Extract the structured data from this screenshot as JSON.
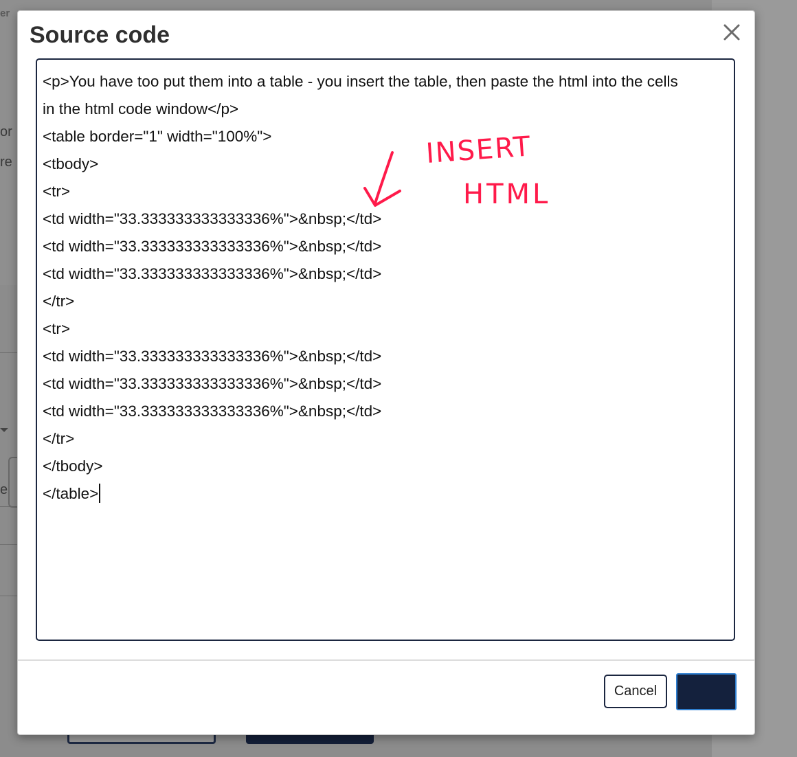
{
  "background": {
    "fragments": [
      "er",
      "or",
      "re",
      "e"
    ]
  },
  "dialog": {
    "title": "Source code",
    "close_icon": "close-icon",
    "code_lines": [
      "<p>You have too put them into a table - you insert the table, then paste the html into the cells",
      "in the html code window</p>",
      "<table border=\"1\" width=\"100%\">",
      "<tbody>",
      "<tr>",
      "<td width=\"33.333333333333336%\">&nbsp;</td>",
      "<td width=\"33.333333333333336%\">&nbsp;</td>",
      "<td width=\"33.333333333333336%\">&nbsp;</td>",
      "</tr>",
      "<tr>",
      "<td width=\"33.333333333333336%\">&nbsp;</td>",
      "<td width=\"33.333333333333336%\">&nbsp;</td>",
      "<td width=\"33.333333333333336%\">&nbsp;</td>",
      "</tr>",
      "</tbody>",
      "</table>"
    ],
    "annotation": {
      "line1": "INSERT",
      "line2": "HTML",
      "color": "#ff1a4a"
    },
    "buttons": {
      "cancel_label": "Cancel",
      "save_label": ""
    }
  }
}
